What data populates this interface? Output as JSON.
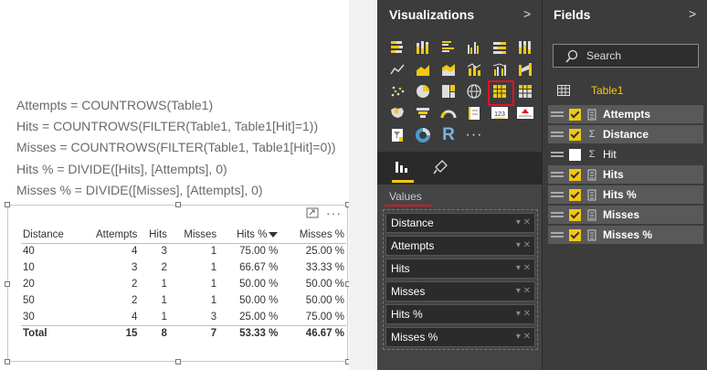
{
  "formulas": [
    "Attempts = COUNTROWS(Table1)",
    "Hits = COUNTROWS(FILTER(Table1, Table1[Hit]=1))",
    "Misses = COUNTROWS(FILTER(Table1, Table1[Hit]=0))",
    "Hits % = DIVIDE([Hits], [Attempts], 0)",
    "Misses % = DIVIDE([Misses], [Attempts], 0)"
  ],
  "table": {
    "headers": [
      "Distance",
      "Attempts",
      "Hits",
      "Misses",
      "Hits %",
      "Misses %"
    ],
    "rows": [
      [
        "40",
        "4",
        "3",
        "1",
        "75.00 %",
        "25.00 %"
      ],
      [
        "10",
        "3",
        "2",
        "1",
        "66.67 %",
        "33.33 %"
      ],
      [
        "20",
        "2",
        "1",
        "1",
        "50.00 %",
        "50.00 %"
      ],
      [
        "50",
        "2",
        "1",
        "1",
        "50.00 %",
        "50.00 %"
      ],
      [
        "30",
        "4",
        "1",
        "3",
        "25.00 %",
        "75.00 %"
      ]
    ],
    "total": [
      "Total",
      "15",
      "8",
      "7",
      "53.33 %",
      "46.67 %"
    ],
    "more_label": "···"
  },
  "visualizations": {
    "title": "Visualizations",
    "chevron": ">",
    "tabs_more": "···",
    "values_label": "Values",
    "wells": [
      "Distance",
      "Attempts",
      "Hits",
      "Misses",
      "Hits %",
      "Misses %"
    ],
    "icons": [
      "stacked-bar-icon",
      "stacked-column-icon",
      "clustered-bar-icon",
      "clustered-column-icon",
      "100-bar-icon",
      "100-column-icon",
      "line-chart-icon",
      "area-chart-icon",
      "stacked-area-icon",
      "line-column-icon",
      "line-clustered-icon",
      "ribbon-chart-icon",
      "scatter-icon",
      "pie-chart-icon",
      "treemap-icon",
      "map-icon",
      "table-icon",
      "matrix-icon",
      "filled-map-icon",
      "funnel-icon",
      "gauge-icon",
      "multirow-card-icon",
      "card-icon",
      "kpi-icon",
      "slicer-icon",
      "donut-icon",
      "r-visual-icon",
      "more-visuals-icon"
    ],
    "selected_icon": "table-icon",
    "r_label": "R",
    "card_label": "123",
    "more_label": "···"
  },
  "fields": {
    "title": "Fields",
    "chevron": ">",
    "search_placeholder": "Search",
    "table_name": "Table1",
    "sum_symbol": "Σ",
    "items": [
      {
        "name": "Attempts",
        "checked": true,
        "type": "measure"
      },
      {
        "name": "Distance",
        "checked": true,
        "type": "sum"
      },
      {
        "name": "Hit",
        "checked": false,
        "type": "sum"
      },
      {
        "name": "Hits",
        "checked": true,
        "type": "measure"
      },
      {
        "name": "Hits %",
        "checked": true,
        "type": "measure"
      },
      {
        "name": "Misses",
        "checked": true,
        "type": "measure"
      },
      {
        "name": "Misses %",
        "checked": true,
        "type": "measure"
      }
    ]
  },
  "colors": {
    "accent_yellow": "#f2c811",
    "selected_red": "#e81123",
    "pane_bg": "#3c3c3c"
  }
}
